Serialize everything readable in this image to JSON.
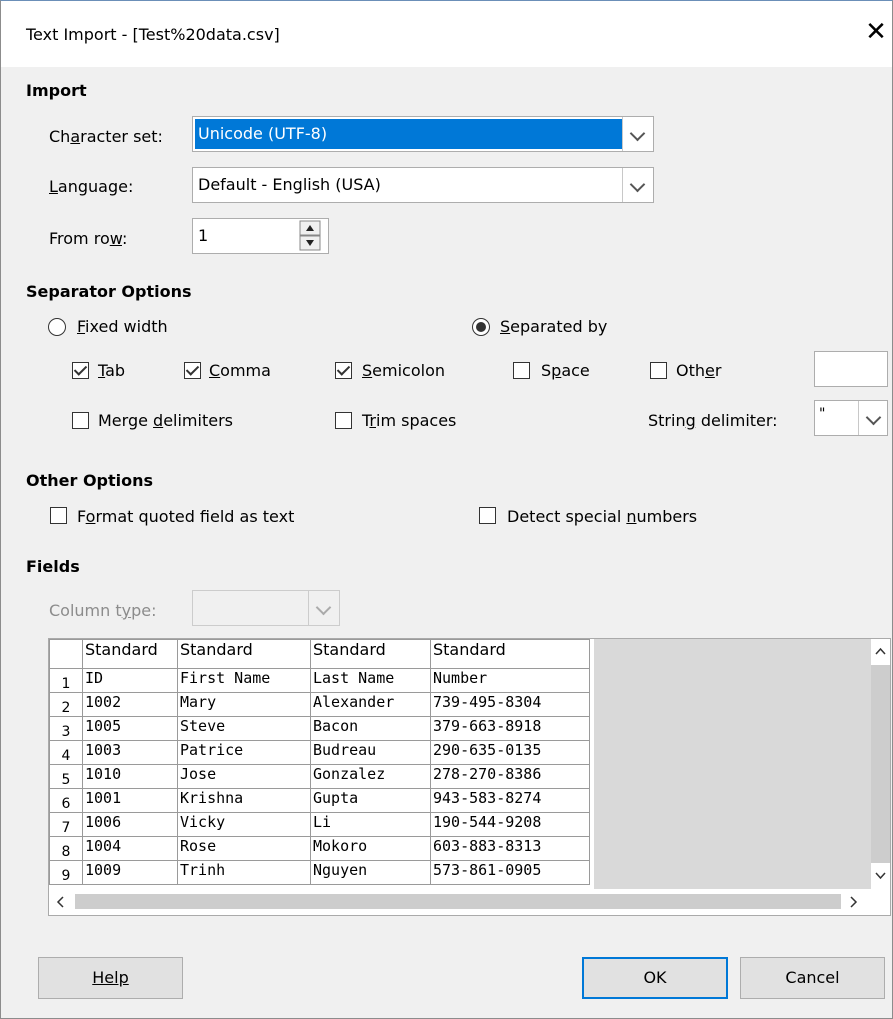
{
  "window": {
    "title": "Text Import - [Test%20data.csv]",
    "close": "✕"
  },
  "import": {
    "heading": "Import",
    "charset_label": "Character set:",
    "charset_value": "Unicode (UTF-8)",
    "language_label": "Language:",
    "language_value": "Default - English (USA)",
    "fromrow_label": "From row:",
    "fromrow_value": "1"
  },
  "separator": {
    "heading": "Separator Options",
    "fixed_width": "Fixed width",
    "separated_by": "Separated by",
    "separated_selected": true,
    "tab": "Tab",
    "tab_checked": true,
    "comma": "Comma",
    "comma_checked": true,
    "semicolon": "Semicolon",
    "semicolon_checked": true,
    "space": "Space",
    "space_checked": false,
    "other": "Other",
    "other_checked": false,
    "other_value": "",
    "merge": "Merge delimiters",
    "merge_checked": false,
    "trim": "Trim spaces",
    "trim_checked": false,
    "string_delim_label": "String delimiter:",
    "string_delim_value": "\""
  },
  "other": {
    "heading": "Other Options",
    "format_quoted": "Format quoted field as text",
    "detect_special": "Detect special numbers"
  },
  "fields": {
    "heading": "Fields",
    "column_type_label": "Column type:",
    "column_type_value": "",
    "headers": [
      "Standard",
      "Standard",
      "Standard",
      "Standard"
    ],
    "rows": [
      {
        "n": "1",
        "c": [
          "ID",
          "First Name",
          "Last Name",
          "Number"
        ]
      },
      {
        "n": "2",
        "c": [
          "1002",
          "Mary",
          "Alexander",
          "739-495-8304"
        ]
      },
      {
        "n": "3",
        "c": [
          "1005",
          "Steve",
          "Bacon",
          "379-663-8918"
        ]
      },
      {
        "n": "4",
        "c": [
          "1003",
          "Patrice",
          "Budreau",
          "290-635-0135"
        ]
      },
      {
        "n": "5",
        "c": [
          "1010",
          "Jose",
          "Gonzalez",
          "278-270-8386"
        ]
      },
      {
        "n": "6",
        "c": [
          "1001",
          "Krishna",
          "Gupta",
          "943-583-8274"
        ]
      },
      {
        "n": "7",
        "c": [
          "1006",
          "Vicky",
          "Li",
          "190-544-9208"
        ]
      },
      {
        "n": "8",
        "c": [
          "1004",
          "Rose",
          "Mokoro",
          "603-883-8313"
        ]
      },
      {
        "n": "9",
        "c": [
          "1009",
          "Trinh",
          "Nguyen",
          "573-861-0905"
        ]
      }
    ]
  },
  "buttons": {
    "help": "Help",
    "ok": "OK",
    "cancel": "Cancel"
  }
}
